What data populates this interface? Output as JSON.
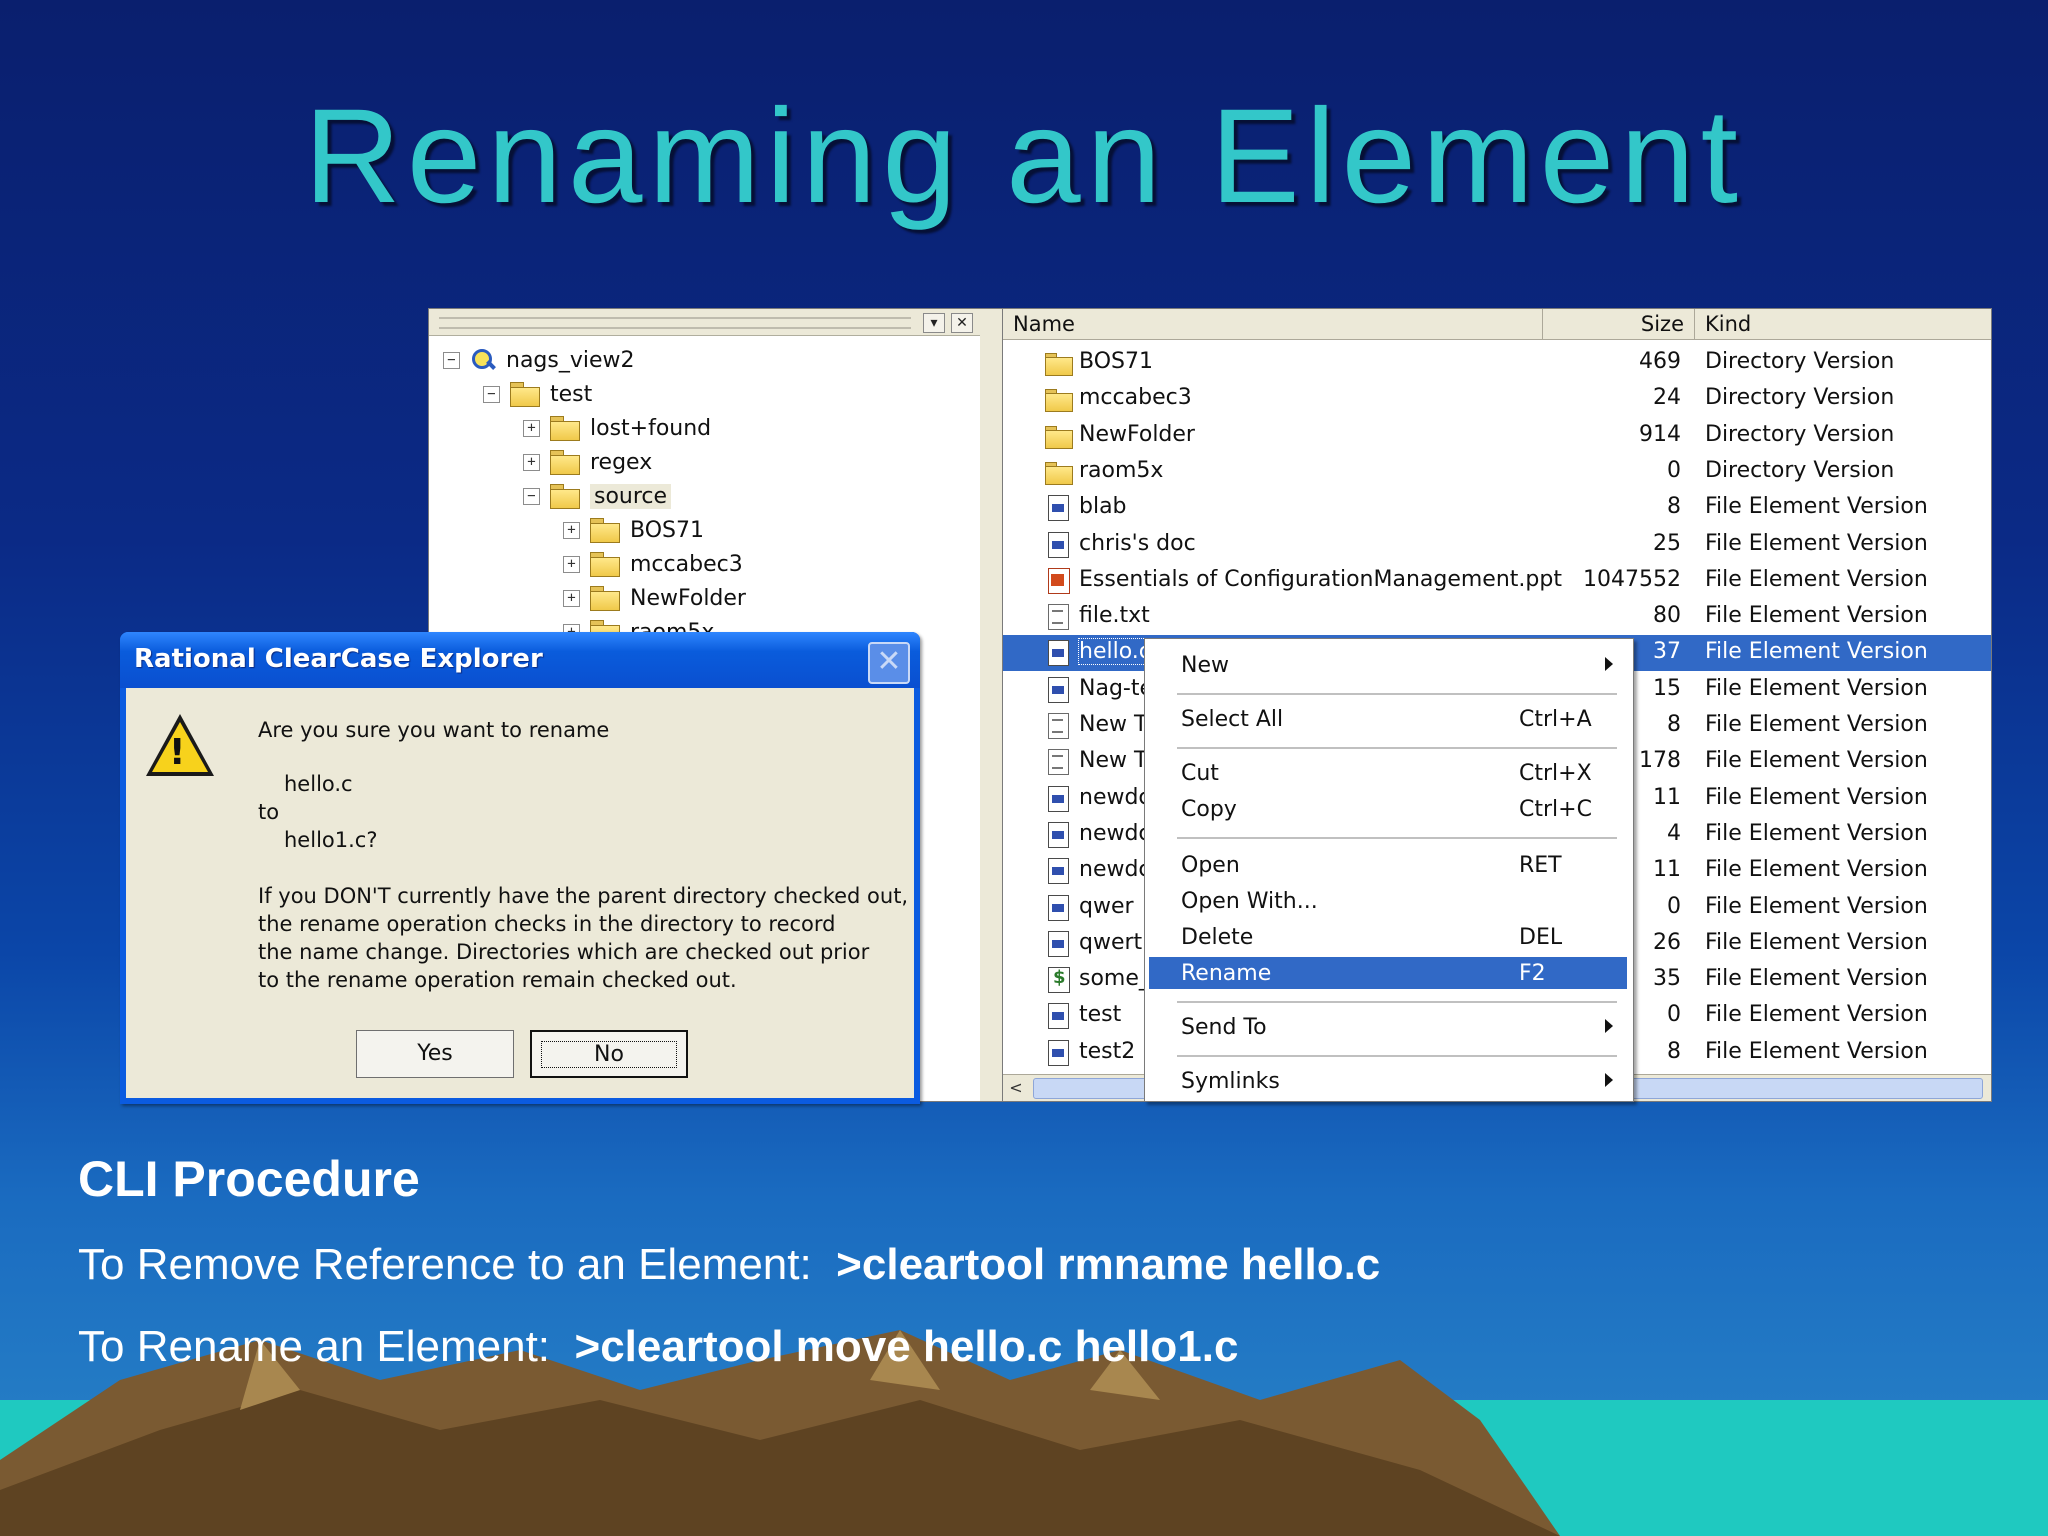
{
  "slide": {
    "title": "Renaming an Element",
    "cli_heading": "CLI Procedure",
    "cli_line_1_label": "To Remove Reference to an Element:",
    "cli_line_1_cmd": ">cleartool rmname hello.c",
    "cli_line_2_label": "To Rename an Element:",
    "cli_line_2_cmd": ">cleartool move hello.c hello1.c"
  },
  "tree": {
    "pane_buttons": [
      "▾",
      "✕"
    ],
    "nodes": [
      {
        "label": "nags_view2",
        "expander": "−"
      },
      {
        "label": "test",
        "expander": "−"
      },
      {
        "label": "lost+found",
        "expander": "+"
      },
      {
        "label": "regex",
        "expander": "+"
      },
      {
        "label": "source",
        "expander": "−"
      },
      {
        "label": "BOS71",
        "expander": "+"
      },
      {
        "label": "mccabec3",
        "expander": "+"
      },
      {
        "label": "NewFolder",
        "expander": "+"
      },
      {
        "label": "raom5x",
        "expander": "+"
      }
    ]
  },
  "list": {
    "columns": {
      "name": "Name",
      "size": "Size",
      "kind": "Kind"
    },
    "rows": [
      {
        "name": "BOS71",
        "size": "469",
        "kind": "Directory Version",
        "icon": "folder"
      },
      {
        "name": "mccabec3",
        "size": "24",
        "kind": "Directory Version",
        "icon": "folder"
      },
      {
        "name": "NewFolder",
        "size": "914",
        "kind": "Directory Version",
        "icon": "folder"
      },
      {
        "name": "raom5x",
        "size": "0",
        "kind": "Directory Version",
        "icon": "folder"
      },
      {
        "name": "blab",
        "size": "8",
        "kind": "File Element Version",
        "icon": "file"
      },
      {
        "name": "chris's doc",
        "size": "25",
        "kind": "File Element Version",
        "icon": "file"
      },
      {
        "name": "Essentials of ConfigurationManagement.ppt",
        "size": "1047552",
        "kind": "File Element Version",
        "icon": "ppt"
      },
      {
        "name": "file.txt",
        "size": "80",
        "kind": "File Element Version",
        "icon": "txt"
      },
      {
        "name": "hello.c",
        "size": "37",
        "kind": "File Element Version",
        "icon": "file",
        "selected": true
      },
      {
        "name": "Nag-te",
        "size": "15",
        "kind": "File Element Version",
        "icon": "file"
      },
      {
        "name": "New T",
        "size": "8",
        "kind": "File Element Version",
        "icon": "txt"
      },
      {
        "name": "New T",
        "size": "178",
        "kind": "File Element Version",
        "icon": "txt"
      },
      {
        "name": "newdc",
        "size": "11",
        "kind": "File Element Version",
        "icon": "file"
      },
      {
        "name": "newdc",
        "size": "4",
        "kind": "File Element Version",
        "icon": "file"
      },
      {
        "name": "newdc",
        "size": "11",
        "kind": "File Element Version",
        "icon": "file"
      },
      {
        "name": "qwer",
        "size": "0",
        "kind": "File Element Version",
        "icon": "file"
      },
      {
        "name": "qwert",
        "size": "26",
        "kind": "File Element Version",
        "icon": "file"
      },
      {
        "name": "some_",
        "size": "35",
        "kind": "File Element Version",
        "icon": "exe"
      },
      {
        "name": "test",
        "size": "0",
        "kind": "File Element Version",
        "icon": "file"
      },
      {
        "name": "test2",
        "size": "8",
        "kind": "File Element Version",
        "icon": "file"
      }
    ],
    "scroll_left": "<"
  },
  "context_menu": {
    "items": [
      {
        "label": "New",
        "key": "",
        "submenu": true
      },
      {
        "label": "Select All",
        "key": "Ctrl+A"
      },
      {
        "label": "Cut",
        "key": "Ctrl+X"
      },
      {
        "label": "Copy",
        "key": "Ctrl+C"
      },
      {
        "label": "Open",
        "key": "RET"
      },
      {
        "label": "Open With...",
        "key": ""
      },
      {
        "label": "Delete",
        "key": "DEL"
      },
      {
        "label": "Rename",
        "key": "F2",
        "highlighted": true
      },
      {
        "label": "Send To",
        "key": "",
        "submenu": true
      },
      {
        "label": "Symlinks",
        "key": "",
        "submenu": true
      }
    ]
  },
  "dialog": {
    "title": "Rational ClearCase Explorer",
    "close": "✕",
    "line_question": "Are you sure you want to rename",
    "line_old": "hello.c",
    "line_to": "to",
    "line_new": "hello1.c?",
    "note_1": "If you DON'T currently have the parent directory checked out,",
    "note_2": "the rename operation checks in the directory to record",
    "note_3": "the name change.  Directories which are checked out prior",
    "note_4": "to the rename operation remain checked out.",
    "yes_label": "Yes",
    "no_label": "No"
  },
  "colors": {
    "title": "#33c7c9",
    "selection": "#3169c6",
    "dialog_titlebar": "#0a5cdc"
  }
}
